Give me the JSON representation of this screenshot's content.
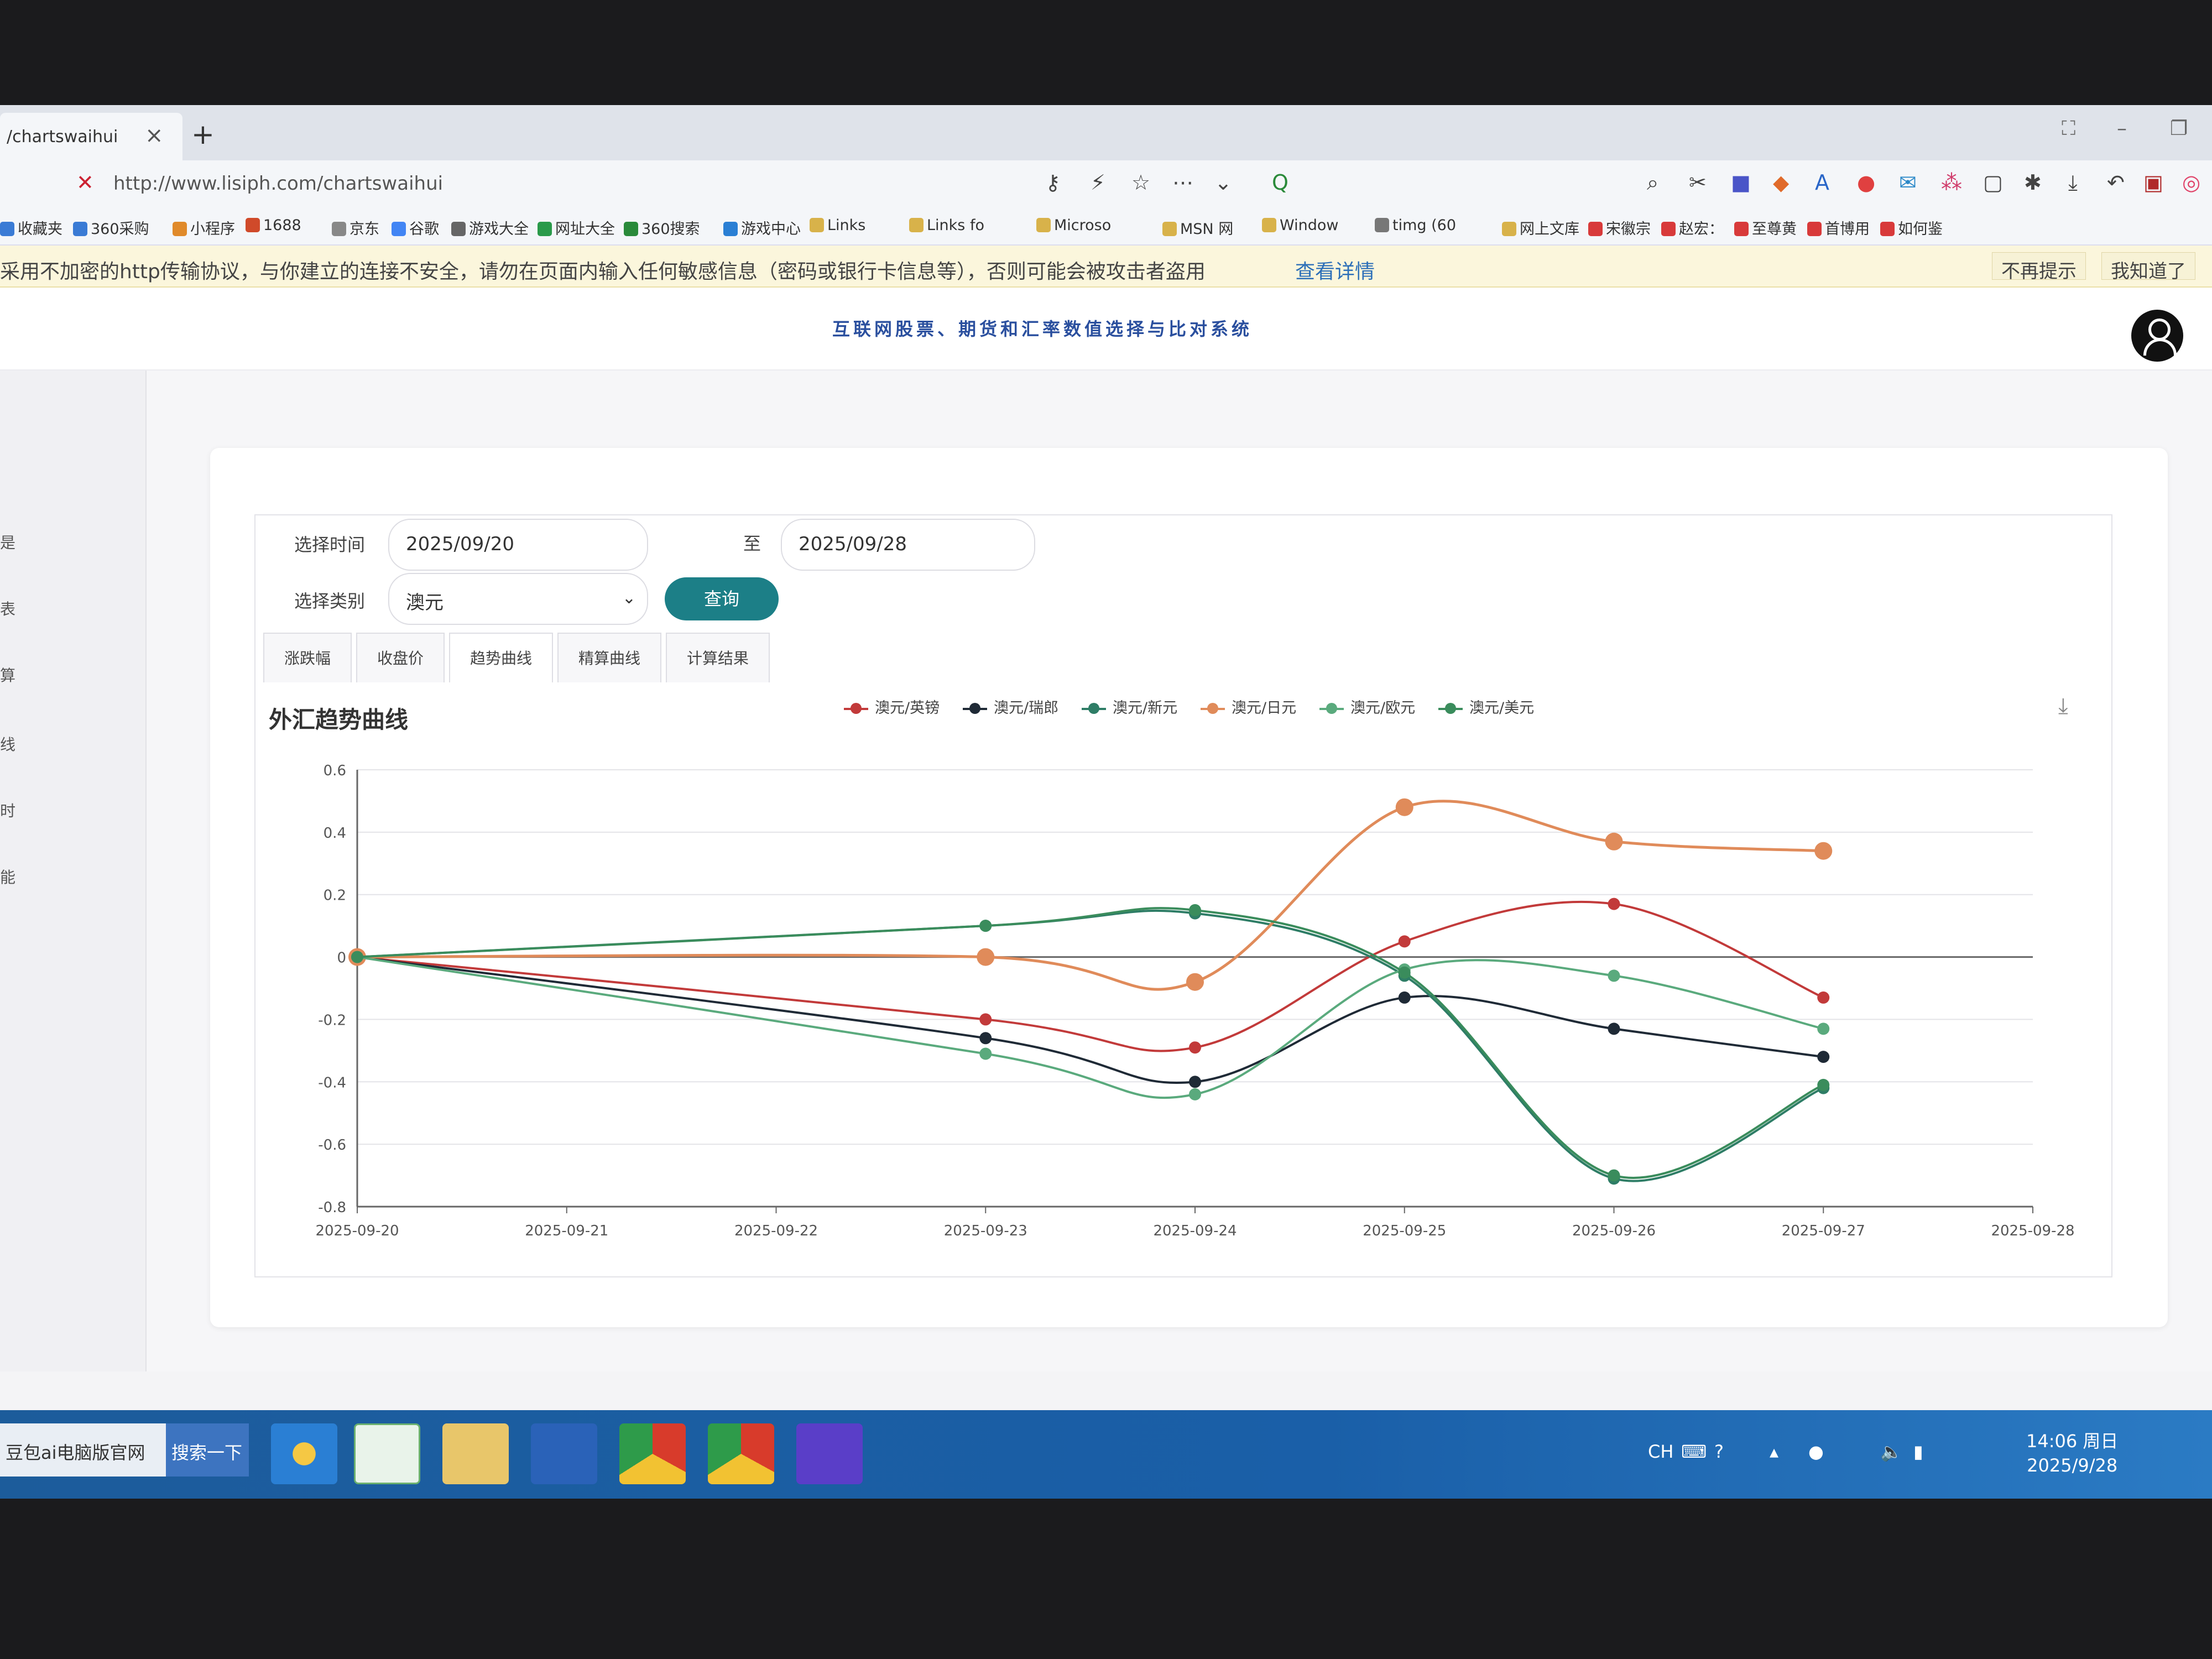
{
  "browser": {
    "tab_title": "/chartswaihui",
    "tab_close": "×",
    "new_tab": "+",
    "url": "http://www.lisiph.com/chartswaihui",
    "bookmarks": [
      "收藏夹",
      "360采购",
      "小程序",
      "1688",
      "京东",
      "谷歌",
      "游戏大全",
      "网址大全",
      "360搜索",
      "游戏中心",
      "Links",
      "Links fo",
      "Microso",
      "MSN 网",
      "Window",
      "timg (60",
      "网上文库",
      "宋徽宗",
      "赵宏：",
      "至尊黄",
      "首博用",
      "如何鉴"
    ],
    "warning": {
      "text": "采用不加密的http传输协议，与你建立的连接不安全，请勿在页面内输入任何敏感信息（密码或银行卡信息等），否则可能会被攻击者盗用",
      "link": "查看详情",
      "btn_no_remind": "不再提示",
      "btn_ok": "我知道了"
    }
  },
  "site": {
    "title": "互联网股票、期货和汇率数值选择与比对系统",
    "side_items": [
      "是",
      "表",
      "算",
      "线",
      "时",
      "能"
    ]
  },
  "form": {
    "time_label": "选择时间",
    "date_from": "2025/09/20",
    "to_label": "至",
    "date_to": "2025/09/28",
    "category_label": "选择类别",
    "category_value": "澳元",
    "query_btn": "查询"
  },
  "tabs": [
    "涨跌幅",
    "收盘价",
    "趋势曲线",
    "精算曲线",
    "计算结果"
  ],
  "chart_data": {
    "type": "line",
    "title": "外汇趋势曲线",
    "x": [
      "2025-09-20",
      "2025-09-21",
      "2025-09-22",
      "2025-09-23",
      "2025-09-24",
      "2025-09-25",
      "2025-09-26",
      "2025-09-27",
      "2025-09-28"
    ],
    "yticks": [
      "0.6",
      "0.4",
      "0.2",
      "0",
      "-0.2",
      "-0.4",
      "-0.6",
      "-0.8"
    ],
    "ylim": [
      -0.8,
      0.6
    ],
    "legend_position": "top",
    "series": [
      {
        "name": "澳元/英镑",
        "color": "#c23a3a",
        "x": [
          "2025-09-20",
          "2025-09-23",
          "2025-09-24",
          "2025-09-25",
          "2025-09-26",
          "2025-09-27"
        ],
        "values": [
          0,
          -0.2,
          -0.29,
          0.05,
          0.17,
          -0.13
        ]
      },
      {
        "name": "澳元/瑞郎",
        "color": "#1f2a36",
        "x": [
          "2025-09-20",
          "2025-09-23",
          "2025-09-24",
          "2025-09-25",
          "2025-09-26",
          "2025-09-27"
        ],
        "values": [
          0,
          -0.26,
          -0.4,
          -0.13,
          -0.23,
          -0.32
        ]
      },
      {
        "name": "澳元/新元",
        "color": "#2e7d66",
        "x": [
          "2025-09-20",
          "2025-09-23",
          "2025-09-24",
          "2025-09-25",
          "2025-09-26",
          "2025-09-27"
        ],
        "values": [
          0,
          0.1,
          0.14,
          -0.06,
          -0.71,
          -0.42
        ]
      },
      {
        "name": "澳元/日元",
        "color": "#e08b5a",
        "x": [
          "2025-09-20",
          "2025-09-23",
          "2025-09-24",
          "2025-09-25",
          "2025-09-26",
          "2025-09-27"
        ],
        "values": [
          0,
          0,
          -0.08,
          0.48,
          0.37,
          0.34
        ]
      },
      {
        "name": "澳元/欧元",
        "color": "#5aaa7d",
        "x": [
          "2025-09-20",
          "2025-09-23",
          "2025-09-24",
          "2025-09-25",
          "2025-09-26",
          "2025-09-27"
        ],
        "values": [
          0,
          -0.31,
          -0.44,
          -0.04,
          -0.06,
          -0.23
        ]
      },
      {
        "name": "澳元/美元",
        "color": "#3a8c5c",
        "x": [
          "2025-09-20",
          "2025-09-23",
          "2025-09-24",
          "2025-09-25",
          "2025-09-26",
          "2025-09-27"
        ],
        "values": [
          0,
          0.1,
          0.15,
          -0.05,
          -0.7,
          -0.41
        ]
      }
    ]
  },
  "taskbar": {
    "search_text": "豆包ai电脑版官网",
    "search_btn": "搜索一下",
    "lang": "CH",
    "time": "14:06 周日",
    "date": "2025/9/28"
  }
}
